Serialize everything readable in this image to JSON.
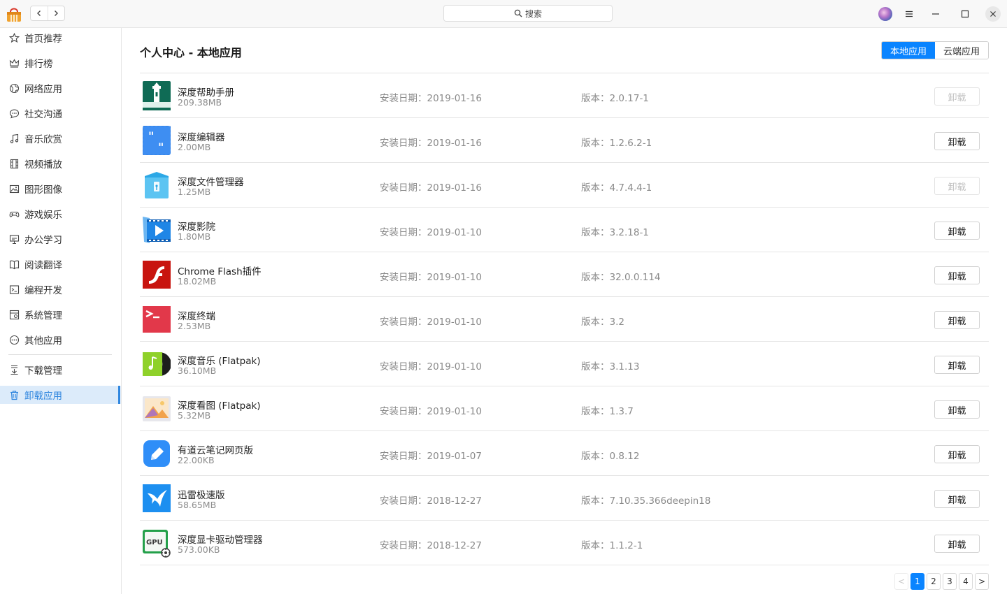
{
  "titlebar": {
    "search_label": "搜索",
    "icons": [
      "deepin-store-logo",
      "back-icon",
      "forward-icon",
      "search-icon",
      "avatar",
      "menu-icon",
      "minimize-icon",
      "maximize-icon",
      "close-icon"
    ]
  },
  "sidebar": {
    "items": [
      {
        "label": "首页推荐",
        "icon": "star-icon"
      },
      {
        "label": "排行榜",
        "icon": "crown-icon"
      },
      {
        "label": "网络应用",
        "icon": "globe-icon"
      },
      {
        "label": "社交沟通",
        "icon": "chat-icon"
      },
      {
        "label": "音乐欣赏",
        "icon": "music-icon"
      },
      {
        "label": "视频播放",
        "icon": "film-icon"
      },
      {
        "label": "图形图像",
        "icon": "image-icon"
      },
      {
        "label": "游戏娱乐",
        "icon": "gamepad-icon"
      },
      {
        "label": "办公学习",
        "icon": "presentation-icon"
      },
      {
        "label": "阅读翻译",
        "icon": "book-icon"
      },
      {
        "label": "编程开发",
        "icon": "terminal-icon"
      },
      {
        "label": "系统管理",
        "icon": "system-icon"
      },
      {
        "label": "其他应用",
        "icon": "more-icon"
      },
      {
        "label": "下载管理",
        "icon": "download-icon"
      },
      {
        "label": "卸载应用",
        "icon": "trash-icon",
        "active": true
      }
    ]
  },
  "main": {
    "title": "个人中心 - 本地应用",
    "tabs": [
      {
        "label": "本地应用",
        "active": true
      },
      {
        "label": "云端应用",
        "active": false
      }
    ],
    "uninstall_label": "卸载",
    "apps": [
      {
        "name": "深度帮助手册",
        "size": "209.38MB",
        "date": "安装日期：2019-01-16",
        "version": "版本：2.0.17-1",
        "disabled": true,
        "icon": "lighthouse-icon"
      },
      {
        "name": "深度编辑器",
        "size": "2.00MB",
        "date": "安装日期：2019-01-16",
        "version": "版本：1.2.6.2-1",
        "disabled": false,
        "icon": "quote-editor-icon"
      },
      {
        "name": "深度文件管理器",
        "size": "1.25MB",
        "date": "安装日期：2019-01-16",
        "version": "版本：4.7.4.4-1",
        "disabled": true,
        "icon": "file-manager-icon"
      },
      {
        "name": "深度影院",
        "size": "1.80MB",
        "date": "安装日期：2019-01-10",
        "version": "版本：3.2.18-1",
        "disabled": false,
        "icon": "movie-player-icon"
      },
      {
        "name": "Chrome Flash插件",
        "size": "18.02MB",
        "date": "安装日期：2019-01-10",
        "version": "版本：32.0.0.114",
        "disabled": false,
        "icon": "flash-icon"
      },
      {
        "name": "深度终端",
        "size": "2.53MB",
        "date": "安装日期：2019-01-10",
        "version": "版本：3.2",
        "disabled": false,
        "icon": "terminal-app-icon"
      },
      {
        "name": "深度音乐 (Flatpak)",
        "size": "36.10MB",
        "date": "安装日期：2019-01-10",
        "version": "版本：3.1.13",
        "disabled": false,
        "icon": "music-player-icon"
      },
      {
        "name": "深度看图 (Flatpak)",
        "size": "5.32MB",
        "date": "安装日期：2019-01-10",
        "version": "版本：1.3.7",
        "disabled": false,
        "icon": "image-viewer-icon"
      },
      {
        "name": "有道云笔记网页版",
        "size": "22.00KB",
        "date": "安装日期：2019-01-07",
        "version": "版本：0.8.12",
        "disabled": false,
        "icon": "youdao-note-icon"
      },
      {
        "name": "迅雷极速版",
        "size": "58.65MB",
        "date": "安装日期：2018-12-27",
        "version": "版本：7.10.35.366deepin18",
        "disabled": false,
        "icon": "thunder-icon"
      },
      {
        "name": "深度显卡驱动管理器",
        "size": "573.00KB",
        "date": "安装日期：2018-12-27",
        "version": "版本：1.1.2-1",
        "disabled": false,
        "icon": "gpu-manager-icon"
      }
    ]
  },
  "pagination": {
    "prev": "<",
    "pages": [
      "1",
      "2",
      "3",
      "4"
    ],
    "current": 1,
    "next": ">"
  },
  "colors": {
    "accent": "#0a84ff",
    "sidebar_active_bg": "#dcebfa",
    "sidebar_active_text": "#2f86df"
  }
}
